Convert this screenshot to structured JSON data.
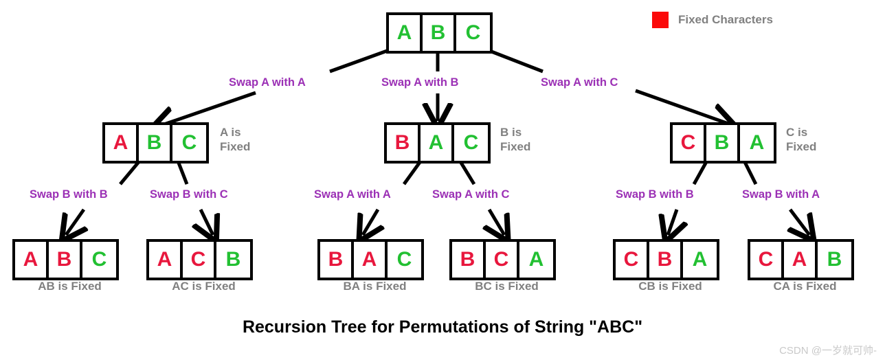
{
  "title": "Recursion Tree for Permutations of String \"ABC\"",
  "watermark": "CSDN @一岁就可帅-",
  "colors": {
    "fixed": "#e8173d",
    "free": "#22c032",
    "legend_swatch": "#fb0a0a",
    "edge_label": "#9b30b5",
    "caption": "#808080",
    "box_border": "#000000"
  },
  "legend": {
    "label": "Fixed Characters",
    "swatch_name": "red-square"
  },
  "nodes": {
    "root": {
      "cells": [
        {
          "letter": "A",
          "state": "free"
        },
        {
          "letter": "B",
          "state": "free"
        },
        {
          "letter": "C",
          "state": "free"
        }
      ],
      "caption": ""
    },
    "level1": [
      {
        "id": "abc",
        "cells": [
          {
            "letter": "A",
            "state": "fixed"
          },
          {
            "letter": "B",
            "state": "free"
          },
          {
            "letter": "C",
            "state": "free"
          }
        ],
        "caption": "A is\nFixed"
      },
      {
        "id": "bac",
        "cells": [
          {
            "letter": "B",
            "state": "fixed"
          },
          {
            "letter": "A",
            "state": "free"
          },
          {
            "letter": "C",
            "state": "free"
          }
        ],
        "caption": "B is\nFixed"
      },
      {
        "id": "cba",
        "cells": [
          {
            "letter": "C",
            "state": "fixed"
          },
          {
            "letter": "B",
            "state": "free"
          },
          {
            "letter": "A",
            "state": "free"
          }
        ],
        "caption": "C is\nFixed"
      }
    ],
    "leaves": [
      {
        "id": "abc-leaf",
        "cells": [
          {
            "letter": "A",
            "state": "fixed"
          },
          {
            "letter": "B",
            "state": "fixed"
          },
          {
            "letter": "C",
            "state": "free"
          }
        ],
        "caption": "AB is Fixed"
      },
      {
        "id": "acb-leaf",
        "cells": [
          {
            "letter": "A",
            "state": "fixed"
          },
          {
            "letter": "C",
            "state": "fixed"
          },
          {
            "letter": "B",
            "state": "free"
          }
        ],
        "caption": "AC is Fixed"
      },
      {
        "id": "bac-leaf",
        "cells": [
          {
            "letter": "B",
            "state": "fixed"
          },
          {
            "letter": "A",
            "state": "fixed"
          },
          {
            "letter": "C",
            "state": "free"
          }
        ],
        "caption": "BA is Fixed"
      },
      {
        "id": "bca-leaf",
        "cells": [
          {
            "letter": "B",
            "state": "fixed"
          },
          {
            "letter": "C",
            "state": "fixed"
          },
          {
            "letter": "A",
            "state": "free"
          }
        ],
        "caption": "BC is Fixed"
      },
      {
        "id": "cba-leaf",
        "cells": [
          {
            "letter": "C",
            "state": "fixed"
          },
          {
            "letter": "B",
            "state": "fixed"
          },
          {
            "letter": "A",
            "state": "free"
          }
        ],
        "caption": "CB is Fixed"
      },
      {
        "id": "cab-leaf",
        "cells": [
          {
            "letter": "C",
            "state": "fixed"
          },
          {
            "letter": "A",
            "state": "fixed"
          },
          {
            "letter": "B",
            "state": "free"
          }
        ],
        "caption": "CA is Fixed"
      }
    ]
  },
  "edge_labels": {
    "level1": [
      "Swap A with A",
      "Swap A with B",
      "Swap A with C"
    ],
    "level2": [
      "Swap B with B",
      "Swap B with C",
      "Swap A with A",
      "Swap A with C",
      "Swap B with B",
      "Swap B with A"
    ]
  }
}
